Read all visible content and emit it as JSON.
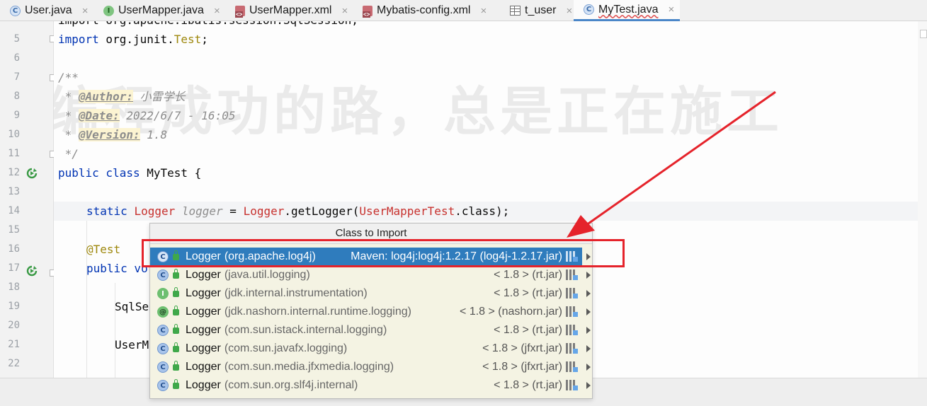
{
  "tabs": [
    {
      "label": "User.java",
      "icon": "class-icon"
    },
    {
      "label": "UserMapper.java",
      "icon": "interface-icon"
    },
    {
      "label": "UserMapper.xml",
      "icon": "xml-file-icon"
    },
    {
      "label": "Mybatis-config.xml",
      "icon": "xml-file-icon"
    },
    {
      "label": "t_user",
      "icon": "table-icon"
    },
    {
      "label": "MyTest.java",
      "icon": "class-icon",
      "active": true
    }
  ],
  "tab_close_glyph": "×",
  "gutter": {
    "line_numbers": [
      "5",
      "6",
      "7",
      "8",
      "9",
      "10",
      "11",
      "12",
      "13",
      "14",
      "15",
      "16",
      "17",
      "18",
      "19",
      "20",
      "21",
      "22"
    ]
  },
  "code": {
    "l4": "import org.apache.ibatis.session.SqlSession;",
    "l5_kw": "import",
    "l5_rest": " org.junit.",
    "l5_cls": "Test",
    "l5_end": ";",
    "l7": "/**",
    "l8_pre": " * ",
    "l8_tag": "@Author:",
    "l8_val": " 小雷学长",
    "l9_pre": " * ",
    "l9_tag": "@Date:",
    "l9_val": " 2022/6/7 - 16:05",
    "l10_pre": " * ",
    "l10_tag": "@Version:",
    "l10_val": " 1.8",
    "l11": " */",
    "l12_kw": "public class",
    "l12_name": " MyTest ",
    "l12_brace": "{",
    "l14_kw": "static",
    "l14_type": "Logger",
    "l14_var": "logger",
    "l14_eq": " = ",
    "l14_type2": "Logger",
    "l14_call": ".getLogger(",
    "l14_arg": "UserMapperTest",
    "l14_end": ".class);",
    "l16_ann": "@Test",
    "l17_kw": "public vo",
    "l19": "SqlSe",
    "l21": "UserM"
  },
  "watermark": "编程成功的路，总是正在施工",
  "popup": {
    "title": "Class to Import",
    "items": [
      {
        "icon": "class-icon",
        "name": "Logger",
        "pkg": "(org.apache.log4j)",
        "location": "Maven: log4j:log4j:1.2.17 (log4j-1.2.17.jar)",
        "selected": true
      },
      {
        "icon": "class-icon",
        "name": "Logger",
        "pkg": "(java.util.logging)",
        "location": "< 1.8 > (rt.jar)"
      },
      {
        "icon": "interface-icon",
        "name": "Logger",
        "pkg": "(jdk.internal.instrumentation)",
        "location": "< 1.8 > (rt.jar)"
      },
      {
        "icon": "annotation-icon",
        "name": "Logger",
        "pkg": "(jdk.nashorn.internal.runtime.logging)",
        "location": "< 1.8 > (nashorn.jar)"
      },
      {
        "icon": "class-icon",
        "name": "Logger",
        "pkg": "(com.sun.istack.internal.logging)",
        "location": "< 1.8 > (rt.jar)"
      },
      {
        "icon": "class-icon",
        "name": "Logger",
        "pkg": "(com.sun.javafx.logging)",
        "location": "< 1.8 > (jfxrt.jar)"
      },
      {
        "icon": "class-icon",
        "name": "Logger",
        "pkg": "(com.sun.media.jfxmedia.logging)",
        "location": "< 1.8 > (jfxrt.jar)"
      },
      {
        "icon": "class-icon",
        "name": "Logger",
        "pkg": "(com.sun.org.slf4j.internal)",
        "location": "< 1.8 > (rt.jar)"
      }
    ]
  },
  "icon_glyphs": {
    "class": "C",
    "interface": "I",
    "annotation": "@"
  },
  "colors": {
    "selection": "#2f7cbd",
    "popup_bg": "#f4f3e3",
    "annotation_red": "#e5232b",
    "keyword": "#0033b3"
  }
}
